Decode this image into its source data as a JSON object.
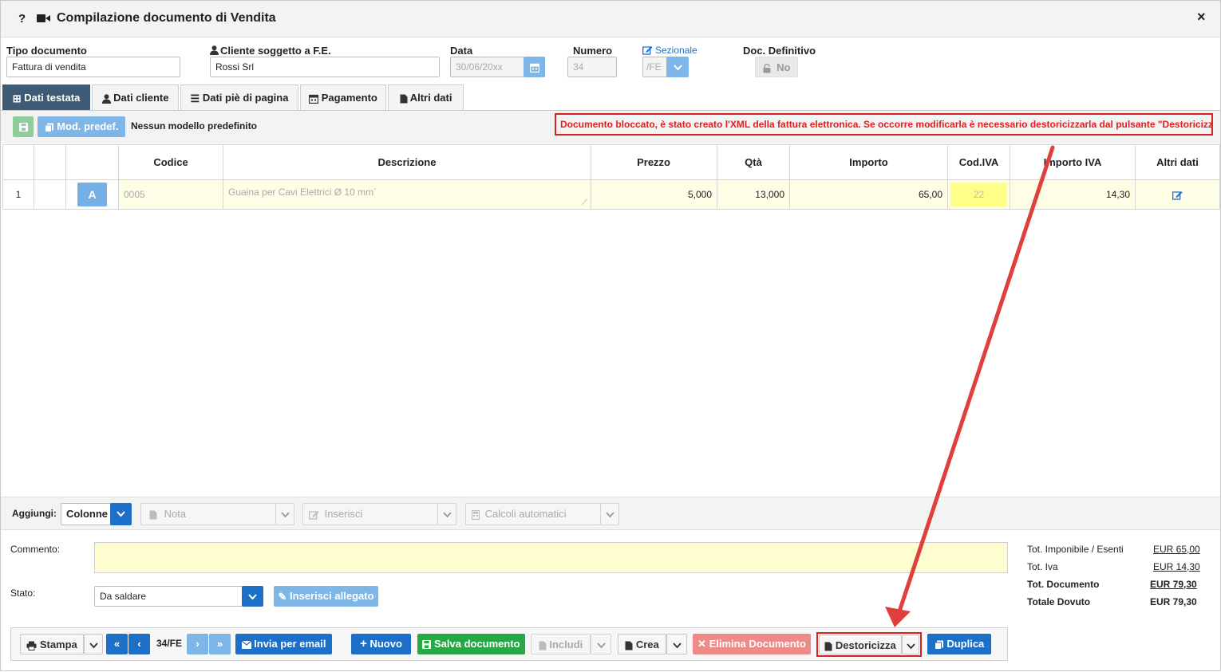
{
  "window": {
    "title": "Compilazione documento di Vendita",
    "help": "?",
    "close": "×"
  },
  "header": {
    "tipo_label": "Tipo documento",
    "tipo_value": "Fattura di vendita",
    "cliente_label": "Cliente soggetto a F.E.",
    "cliente_value": "Rossi Srl",
    "data_label": "Data",
    "data_value": "30/06/20xx",
    "numero_label": "Numero",
    "numero_value": "34",
    "sezionale_label": "Sezionale",
    "sezionale_value": "/FE",
    "definitivo_label": "Doc. Definitivo",
    "definitivo_value": "No"
  },
  "tabs": [
    "Dati testata",
    "Dati cliente",
    "Dati piè di pagina",
    "Pagamento",
    "Altri dati"
  ],
  "toolbar": {
    "mod_label": "Mod. predef.",
    "no_model": "Nessun modello predefinito",
    "warning": "Documento bloccato, è stato creato l'XML della fattura elettronica. Se occorre modificarla è necessario destoricizzarla dal pulsante \"Destoricizza\""
  },
  "table": {
    "columns": [
      "",
      "",
      "",
      "Codice",
      "Descrizione",
      "Prezzo",
      "Qtà",
      "Importo",
      "Cod.IVA",
      "Importo IVA",
      "Altri dati"
    ],
    "rows": [
      {
        "n": "1",
        "badge": "A",
        "codice": "0005",
        "descrizione": "Guaina per Cavi Elettrici Ø 10 mm´",
        "prezzo": "5,000",
        "qta": "13,000",
        "importo": "65,00",
        "codiva": "22",
        "importo_iva": "14,30"
      }
    ]
  },
  "aggiungi": {
    "label": "Aggiungi:",
    "colonne": "Colonne",
    "nota": "Nota",
    "inserisci": "Inserisci",
    "calcoli": "Calcoli automatici"
  },
  "footer": {
    "commento_label": "Commento:",
    "stato_label": "Stato:",
    "stato_value": "Da saldare",
    "allegato": "Inserisci allegato"
  },
  "totals": {
    "imponibile_label": "Tot. Imponibile / Esenti",
    "imponibile_value": "EUR 65,00",
    "iva_label": "Tot. Iva",
    "iva_value": "EUR 14,30",
    "documento_label": "Tot. Documento",
    "documento_value": "EUR 79,30",
    "dovuto_label": "Totale Dovuto",
    "dovuto_value": "EUR 79,30"
  },
  "actions": {
    "stampa": "Stampa",
    "page": "34/FE",
    "email": "Invia per email",
    "nuovo": "Nuovo",
    "salva": "Salva documento",
    "includi": "Includi",
    "crea": "Crea",
    "elimina": "Elimina Documento",
    "destoricizza": "Destoricizza",
    "duplica": "Duplica"
  },
  "colors": {
    "accent": "#1e6fc8",
    "tab_active": "#3f5a74",
    "warning": "#e02020",
    "arrow": "#e0403c",
    "green": "#28a745"
  }
}
